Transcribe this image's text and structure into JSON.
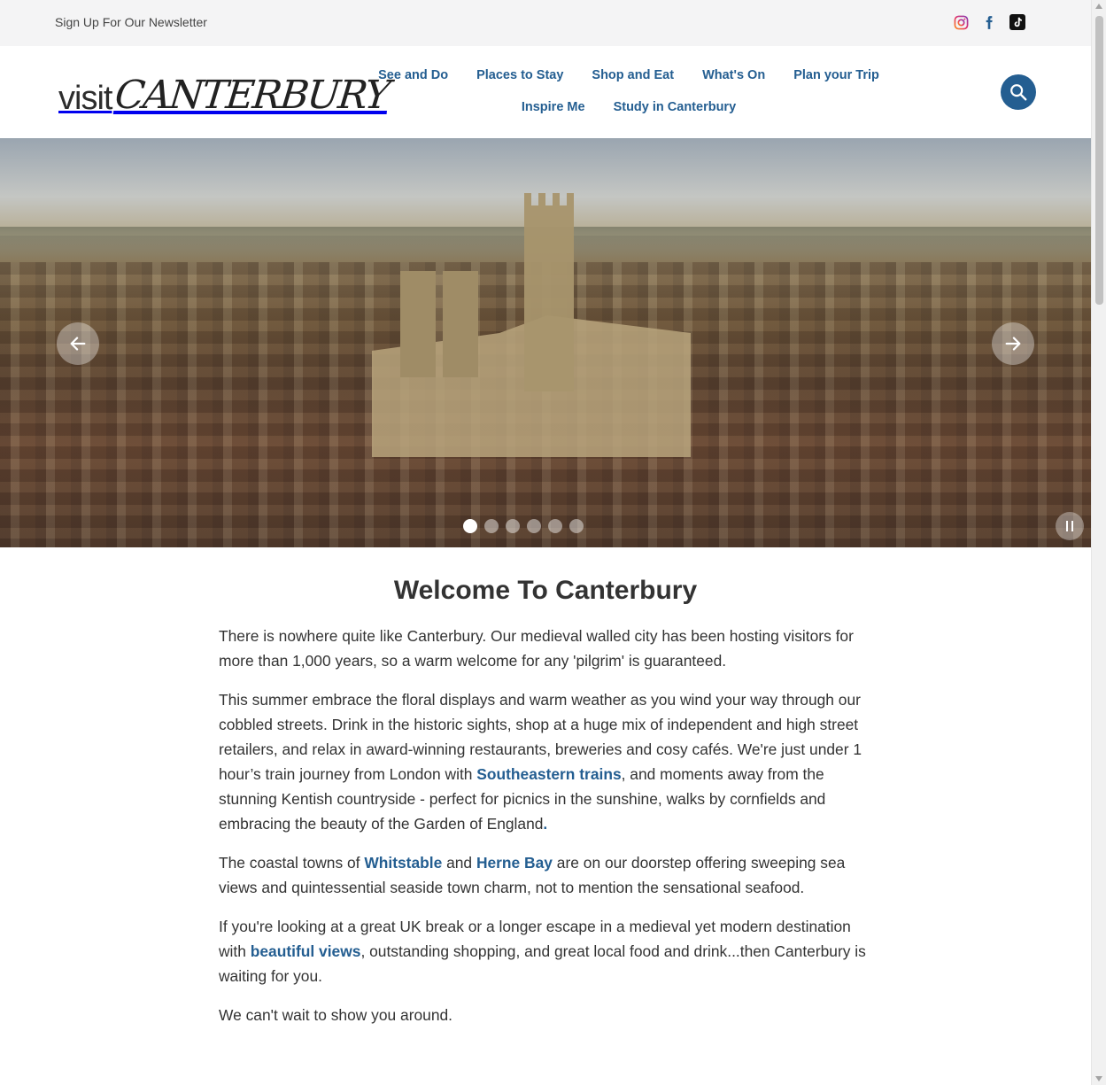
{
  "topbar": {
    "newsletter_label": "Sign Up For Our Newsletter",
    "socials": [
      {
        "name": "instagram-icon"
      },
      {
        "name": "facebook-icon"
      },
      {
        "name": "tiktok-icon"
      }
    ]
  },
  "header": {
    "logo_part1": "visit",
    "logo_part2": "CANTERBURY",
    "nav": [
      "See and Do",
      "Places to Stay",
      "Shop and Eat",
      "What's On",
      "Plan your Trip",
      "Inspire Me",
      "Study in Canterbury"
    ]
  },
  "hero": {
    "slide_count": 6,
    "active_slide": 1
  },
  "main": {
    "title": "Welcome To Canterbury",
    "p1": "There is nowhere quite like Canterbury. Our medieval walled city has been hosting visitors for more than 1,000 years, so a warm welcome for any 'pilgrim' is guaranteed.",
    "p2_a": "This summer embrace the floral displays and warm weather as you wind your way through our cobbled streets. Drink in the historic sights, shop at a huge mix of independent and high street retailers, and relax in award-winning restaurants, breweries and cosy cafés. We're just under 1 hour’s train journey from London with ",
    "p2_link": "Southeastern trains",
    "p2_b": ", and moments away from the stunning Kentish countryside - perfect for picnics in the sunshine, walks by cornfields and embracing the beauty of the Garden of England",
    "p2_end": ".",
    "p3_a": "The coastal towns of ",
    "p3_link1": "Whitstable",
    "p3_mid": " and ",
    "p3_link2": "Herne Bay",
    "p3_b": " are on our doorstep offering sweeping sea views and quintessential seaside town charm, not to mention the sensational seafood.",
    "p4_a": "If you're looking at a great UK break or a longer escape in a medieval yet modern destination with ",
    "p4_link": "beautiful views",
    "p4_b": ", outstanding shopping, and great local food and drink...then Canterbury is waiting for you.",
    "p5": "We can't wait to show you around."
  },
  "colors": {
    "accent": "#245e91",
    "text": "#333333",
    "topbar_bg": "#f4f4f5"
  }
}
